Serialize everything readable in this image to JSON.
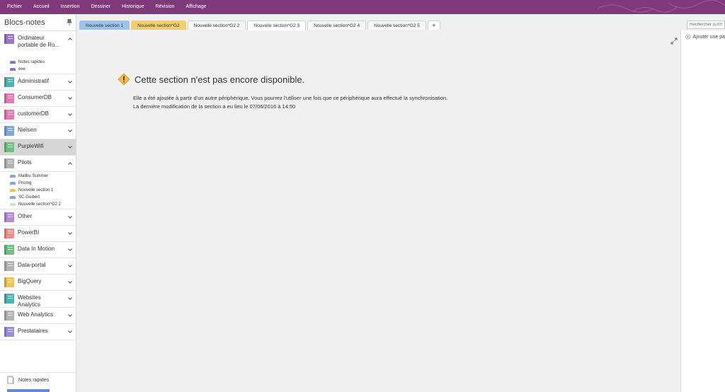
{
  "ribbon": {
    "menu": [
      "Fichier",
      "Accueil",
      "Insertion",
      "Dessiner",
      "Historique",
      "Révision",
      "Affichage"
    ],
    "color": "#80397b"
  },
  "sidebar": {
    "title": "Blocs-notes",
    "notebooks": [
      {
        "name": "Ordinateur portable de Ro...",
        "color": "#9a76c9",
        "expanded": true,
        "sections": [
          {
            "name": "Notes rapides",
            "color": "#8c72c4"
          },
          {
            "name": "eee",
            "color": "#8c72c4"
          }
        ]
      },
      {
        "name": "Administratif",
        "color": "#4fb3b0"
      },
      {
        "name": "ConsumerDB",
        "color": "#e37ab0"
      },
      {
        "name": "customerDB",
        "color": "#e37ab0"
      },
      {
        "name": "Nielsen",
        "color": "#7ea6d6"
      },
      {
        "name": "PurpleWifi",
        "color": "#6fbf83",
        "selected": true
      },
      {
        "name": "Pilots",
        "color": "#b3b3b3",
        "expanded": true,
        "sections": [
          {
            "name": "Malibu Summer",
            "color": "#7ea6d6"
          },
          {
            "name": "Pricing",
            "color": "#7ea6d6"
          },
          {
            "name": "Nouvelle section 1",
            "color": "#e8c94f"
          },
          {
            "name": "SC-Guibert",
            "color": "#7ea6d6"
          },
          {
            "name": "Nouvelle section^G2 2",
            "color": "#d8d8d8"
          }
        ]
      },
      {
        "name": "Other",
        "color": "#b58bd8"
      },
      {
        "name": "PowerBI",
        "color": "#ef8d8d"
      },
      {
        "name": "Data In Motion",
        "color": "#6fbf83"
      },
      {
        "name": "Data-portal",
        "color": "#b3b3b3"
      },
      {
        "name": "BigQuery",
        "color": "#f0c54f"
      },
      {
        "name": "Websites Analytics",
        "color": "#4fb3b0"
      },
      {
        "name": "Web Analytics",
        "color": "#b3b3b3"
      },
      {
        "name": "Prestataires",
        "color": "#9a8ed6"
      }
    ],
    "footer": {
      "quick_notes": "Notes rapides"
    }
  },
  "tabs": [
    {
      "label": "Nouvelle section 1",
      "color": "#9cc1ea"
    },
    {
      "label": "Nouvelle section^G2",
      "color": "#f3cf6a"
    },
    {
      "label": "Nouvelle section^G2 2",
      "color": "#f7f7f7"
    },
    {
      "label": "Nouvelle section^G2 3",
      "color": "#ffffff",
      "active": true
    },
    {
      "label": "Nouvelle section^G2 4",
      "color": "#f7f7f7"
    },
    {
      "label": "Nouvelle section^G2 5",
      "color": "#f7f7f7"
    }
  ],
  "add_tab_label": "+",
  "search": {
    "placeholder": "Rechercher (Ctrl+"
  },
  "message": {
    "title": "Cette section n'est pas encore disponible.",
    "line1": "Elle a été ajoutée à partir d'un autre périphérique. Vous pourrez l'utiliser une fois que ce périphérique aura effectué la synchronisation.",
    "line2": "La dernière modification de la section a eu lieu le 07/06/2016 à 14:50"
  },
  "right_pane": {
    "add_page": "Ajouter une pa"
  }
}
